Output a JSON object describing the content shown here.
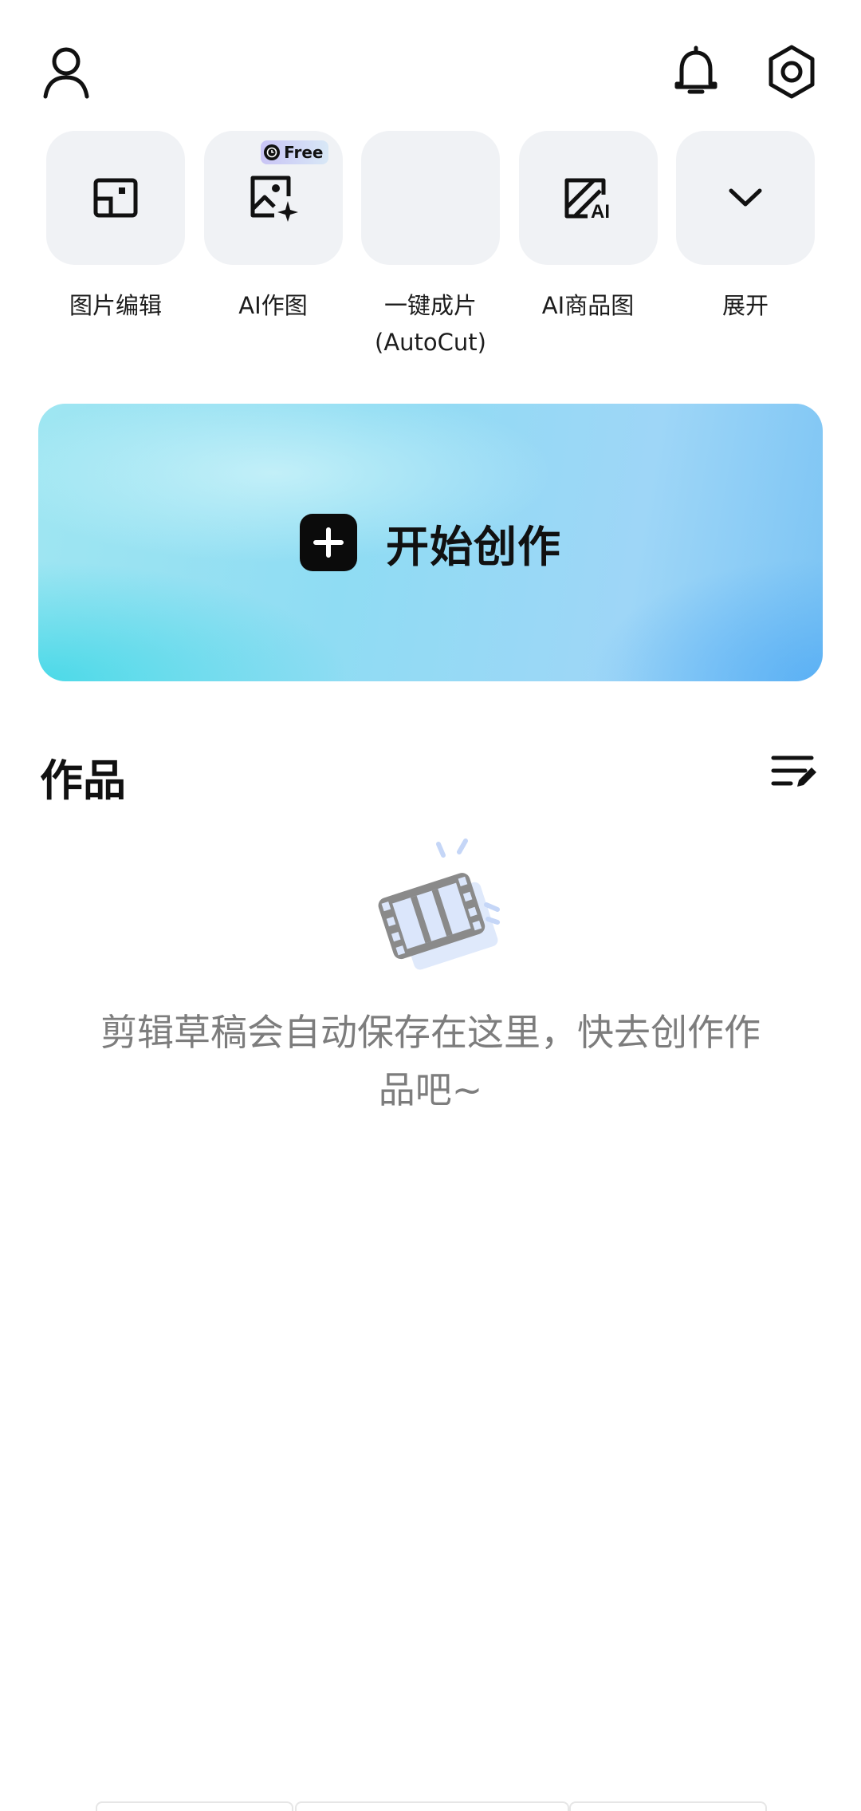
{
  "header": {
    "profile_icon": "person-icon",
    "notification_icon": "bell-icon",
    "settings_icon": "hexagon-settings-icon"
  },
  "tools": [
    {
      "label": "图片编辑",
      "icon": "photo-edit-icon"
    },
    {
      "label": "AI作图",
      "icon": "ai-image-icon",
      "badge": "Free"
    },
    {
      "label": "一键成片\n(AutoCut)",
      "icon": ""
    },
    {
      "label": "AI商品图",
      "icon": "ai-product-icon"
    },
    {
      "label": "展开",
      "icon": "chevron-down-icon"
    }
  ],
  "create": {
    "label": "开始创作",
    "icon": "plus-icon"
  },
  "works": {
    "title": "作品",
    "manage_icon": "edit-list-icon",
    "empty_message": "剪辑草稿会自动保存在这里，快去创作作品吧~"
  },
  "colors": {
    "tile_bg": "#f0f2f5",
    "banner_cyan": "#4fd6e6",
    "banner_blue": "#6db9f3",
    "text_muted": "#7d7d7d"
  }
}
